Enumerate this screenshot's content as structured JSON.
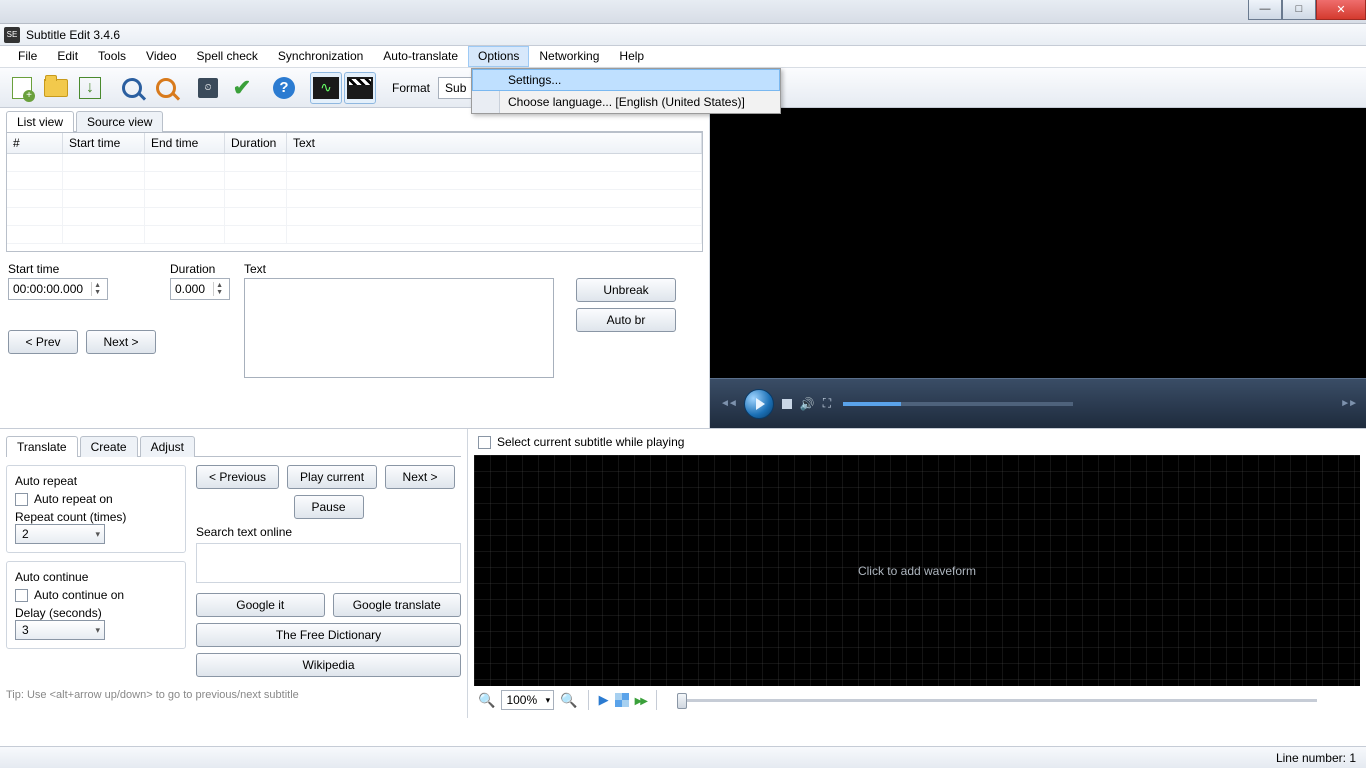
{
  "window": {
    "title": "Subtitle Edit 3.4.6"
  },
  "menu": {
    "file": "File",
    "edit": "Edit",
    "tools": "Tools",
    "video": "Video",
    "spellcheck": "Spell check",
    "sync": "Synchronization",
    "autotrans": "Auto-translate",
    "options": "Options",
    "networking": "Networking",
    "help": "Help"
  },
  "options_menu": {
    "settings": "Settings...",
    "choose_language": "Choose language... [English (United States)]"
  },
  "toolbar": {
    "format_label": "Format",
    "format_partial": "Sub"
  },
  "tabs": {
    "listview": "List view",
    "sourceview": "Source view"
  },
  "grid": {
    "num": "#",
    "start": "Start time",
    "end": "End time",
    "dur": "Duration",
    "text": "Text"
  },
  "edit": {
    "start_label": "Start time",
    "start_val": "00:00:00.000",
    "dur_label": "Duration",
    "dur_val": "0.000",
    "text_label": "Text",
    "unbreak": "Unbreak",
    "autobr": "Auto br",
    "prev": "< Prev",
    "next": "Next >"
  },
  "bottom_tabs": {
    "translate": "Translate",
    "create": "Create",
    "adjust": "Adjust"
  },
  "translate": {
    "autorepeat_title": "Auto repeat",
    "autorepeat_on": "Auto repeat on",
    "repeat_count_label": "Repeat count (times)",
    "repeat_count_val": "2",
    "autocontinue_title": "Auto continue",
    "autocontinue_on": "Auto continue on",
    "delay_label": "Delay (seconds)",
    "delay_val": "3",
    "previous": "< Previous",
    "play_current": "Play current",
    "next": "Next >",
    "pause": "Pause",
    "search_label": "Search text online",
    "google_it": "Google it",
    "google_translate": "Google translate",
    "free_dict": "The Free Dictionary",
    "wikipedia": "Wikipedia",
    "tip": "Tip: Use <alt+arrow up/down> to go to previous/next subtitle"
  },
  "wave": {
    "select_current": "Select current subtitle while playing",
    "placeholder": "Click to add waveform",
    "zoom": "100%"
  },
  "status": {
    "line": "Line number: 1"
  }
}
